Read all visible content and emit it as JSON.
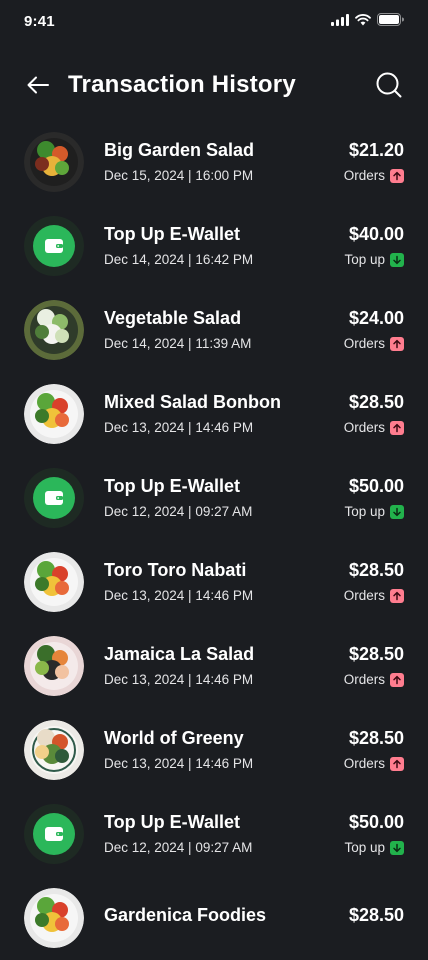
{
  "status": {
    "time": "9:41"
  },
  "header": {
    "title": "Transaction History"
  },
  "colors": {
    "up_badge": "#ff7d8f",
    "down_badge": "#22b24c",
    "wallet_green": "#2bb75a",
    "background": "#1b1d21"
  },
  "transactions": [
    {
      "name": "Big Garden Salad",
      "date": "Dec 15, 2024 | 16:00 PM",
      "amount": "$21.20",
      "type": "Orders",
      "direction": "up",
      "thumb": "salad-dark"
    },
    {
      "name": "Top Up E-Wallet",
      "date": "Dec 14, 2024 | 16:42 PM",
      "amount": "$40.00",
      "type": "Top up",
      "direction": "down",
      "thumb": "wallet-icon"
    },
    {
      "name": "Vegetable Salad",
      "date": "Dec 14, 2024 | 11:39 AM",
      "amount": "$24.00",
      "type": "Orders",
      "direction": "up",
      "thumb": "salad-green"
    },
    {
      "name": "Mixed Salad Bonbon",
      "date": "Dec 13, 2024 | 14:46 PM",
      "amount": "$28.50",
      "type": "Orders",
      "direction": "up",
      "thumb": "salad-white"
    },
    {
      "name": "Top Up E-Wallet",
      "date": "Dec 12, 2024 | 09:27 AM",
      "amount": "$50.00",
      "type": "Top up",
      "direction": "down",
      "thumb": "wallet-icon"
    },
    {
      "name": "Toro Toro Nabati",
      "date": "Dec 13, 2024 | 14:46 PM",
      "amount": "$28.50",
      "type": "Orders",
      "direction": "up",
      "thumb": "salad-white"
    },
    {
      "name": "Jamaica La Salad",
      "date": "Dec 13, 2024 | 14:46 PM",
      "amount": "$28.50",
      "type": "Orders",
      "direction": "up",
      "thumb": "salad-pink"
    },
    {
      "name": "World of Greeny",
      "date": "Dec 13, 2024 | 14:46 PM",
      "amount": "$28.50",
      "type": "Orders",
      "direction": "up",
      "thumb": "salad-bowl"
    },
    {
      "name": "Top Up E-Wallet",
      "date": "Dec 12, 2024 | 09:27 AM",
      "amount": "$50.00",
      "type": "Top up",
      "direction": "down",
      "thumb": "wallet-icon"
    },
    {
      "name": "Gardenica Foodies",
      "date": "",
      "amount": "$28.50",
      "type": "",
      "direction": "",
      "thumb": "salad-white"
    }
  ]
}
